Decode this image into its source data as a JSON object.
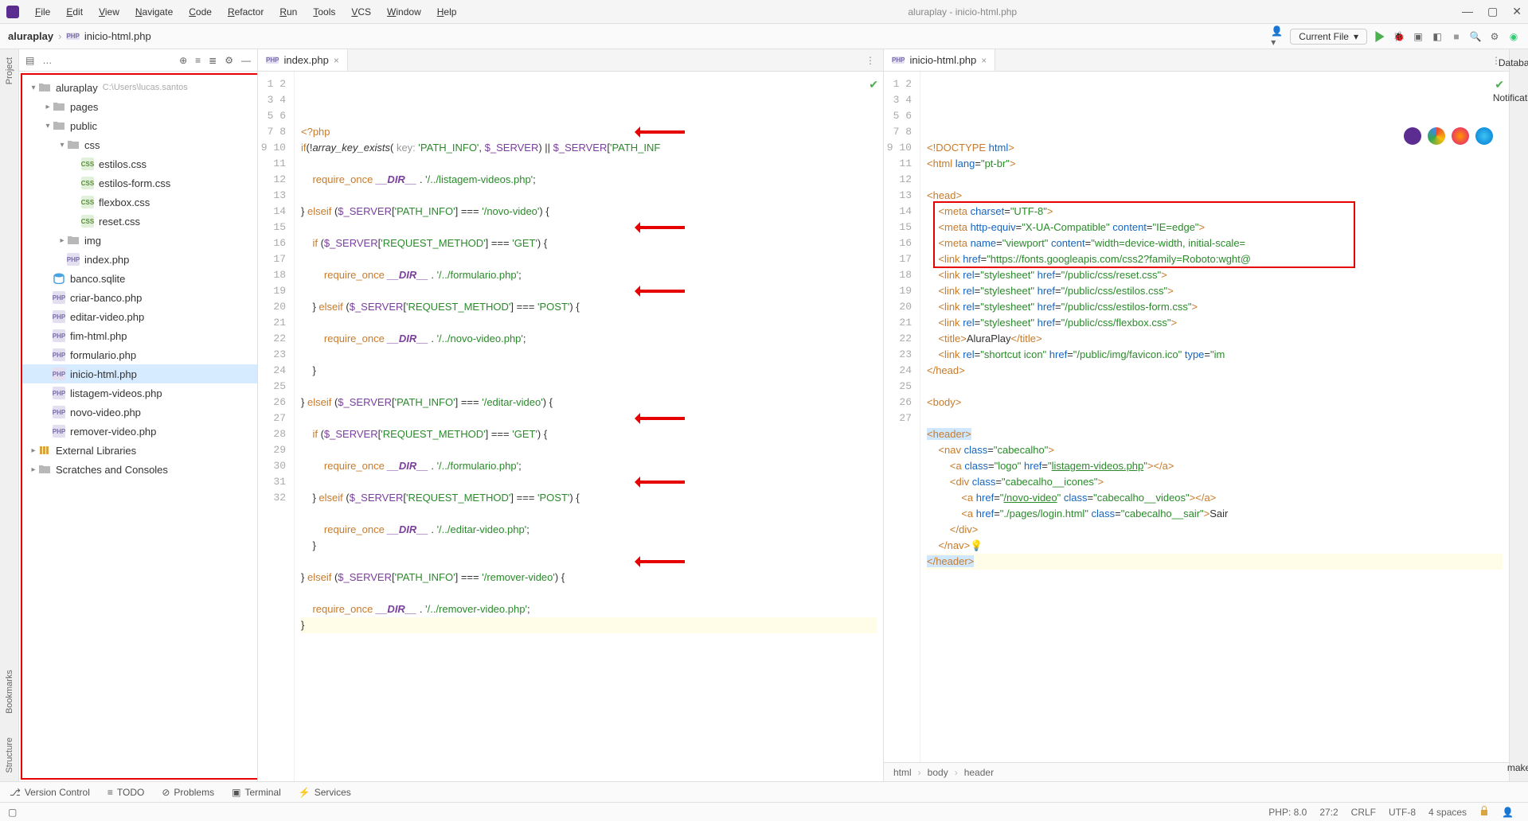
{
  "title": "aluraplay - inicio-html.php",
  "menu": [
    "File",
    "Edit",
    "View",
    "Navigate",
    "Code",
    "Refactor",
    "Run",
    "Tools",
    "VCS",
    "Window",
    "Help"
  ],
  "crumbs": {
    "project": "aluraplay",
    "file": "inicio-html.php"
  },
  "navbar": {
    "target": "Current File"
  },
  "siderail_left": [
    "Project",
    "Bookmarks",
    "Structure"
  ],
  "siderail_right": [
    "Database",
    "Notifications",
    "make"
  ],
  "project_panel": {
    "root": "aluraplay",
    "root_hint": "C:\\Users\\lucas.santos",
    "children": [
      {
        "n": "pages",
        "t": "folder",
        "d": 1,
        "c": "right"
      },
      {
        "n": "public",
        "t": "folder",
        "d": 1,
        "c": "down"
      },
      {
        "n": "css",
        "t": "folder",
        "d": 2,
        "c": "down"
      },
      {
        "n": "estilos.css",
        "t": "css",
        "d": 3
      },
      {
        "n": "estilos-form.css",
        "t": "css",
        "d": 3
      },
      {
        "n": "flexbox.css",
        "t": "css",
        "d": 3
      },
      {
        "n": "reset.css",
        "t": "css",
        "d": 3
      },
      {
        "n": "img",
        "t": "folder",
        "d": 2,
        "c": "right"
      },
      {
        "n": "index.php",
        "t": "php",
        "d": 2
      },
      {
        "n": "banco.sqlite",
        "t": "db",
        "d": 1
      },
      {
        "n": "criar-banco.php",
        "t": "php",
        "d": 1
      },
      {
        "n": "editar-video.php",
        "t": "php",
        "d": 1
      },
      {
        "n": "fim-html.php",
        "t": "php",
        "d": 1
      },
      {
        "n": "formulario.php",
        "t": "php",
        "d": 1
      },
      {
        "n": "inicio-html.php",
        "t": "php",
        "d": 1,
        "sel": true
      },
      {
        "n": "listagem-videos.php",
        "t": "php",
        "d": 1
      },
      {
        "n": "novo-video.php",
        "t": "php",
        "d": 1
      },
      {
        "n": "remover-video.php",
        "t": "php",
        "d": 1
      }
    ],
    "ext_libs": "External Libraries",
    "scratches": "Scratches and Consoles"
  },
  "editor_left": {
    "tab": "index.php",
    "first_line": 1,
    "lines": [
      "<span class='kw'>&lt;?php</span>",
      "<span class='kw'>if</span>(!<span class='fn'>array_key_exists</span>( <span class='hint2'>key:</span> <span class='str'>'PATH_INFO'</span>, <span class='var'>$_SERVER</span>) || <span class='var'>$_SERVER</span>[<span class='str'>'PATH_INF</span>",
      "",
      "    <span class='kw'>require_once</span> <span class='const'>__DIR__</span> . <span class='str'>'/../listagem-videos.php'</span>;",
      "",
      "} <span class='kw'>elseif</span> (<span class='var'>$_SERVER</span>[<span class='str'>'PATH_INFO'</span>] === <span class='str'>'/novo-video'</span>) {",
      "",
      "    <span class='kw'>if</span> (<span class='var'>$_SERVER</span>[<span class='str'>'REQUEST_METHOD'</span>] === <span class='str'>'GET'</span>) {",
      "",
      "        <span class='kw'>require_once</span> <span class='const'>__DIR__</span> . <span class='str'>'/../formulario.php'</span>;",
      "",
      "    } <span class='kw'>elseif</span> (<span class='var'>$_SERVER</span>[<span class='str'>'REQUEST_METHOD'</span>] === <span class='str'>'POST'</span>) {",
      "",
      "        <span class='kw'>require_once</span> <span class='const'>__DIR__</span> . <span class='str'>'/../novo-video.php'</span>;",
      "",
      "    }",
      "",
      "} <span class='kw'>elseif</span> (<span class='var'>$_SERVER</span>[<span class='str'>'PATH_INFO'</span>] === <span class='str'>'/editar-video'</span>) {",
      "",
      "    <span class='kw'>if</span> (<span class='var'>$_SERVER</span>[<span class='str'>'REQUEST_METHOD'</span>] === <span class='str'>'GET'</span>) {",
      "",
      "        <span class='kw'>require_once</span> <span class='const'>__DIR__</span> . <span class='str'>'/../formulario.php'</span>;",
      "",
      "    } <span class='kw'>elseif</span> (<span class='var'>$_SERVER</span>[<span class='str'>'REQUEST_METHOD'</span>] === <span class='str'>'POST'</span>) {",
      "",
      "        <span class='kw'>require_once</span> <span class='const'>__DIR__</span> . <span class='str'>'/../editar-video.php'</span>;",
      "    }",
      "",
      "} <span class='kw'>elseif</span> (<span class='var'>$_SERVER</span>[<span class='str'>'PATH_INFO'</span>] === <span class='str'>'/remover-video'</span>) {",
      "",
      "    <span class='kw'>require_once</span> <span class='const'>__DIR__</span> . <span class='str'>'/../remover-video.php'</span>;",
      "<span class='hlline'>}</span>"
    ],
    "arrows_at": [
      4,
      10,
      14,
      22,
      26,
      31
    ]
  },
  "editor_right": {
    "tab": "inicio-html.php",
    "first_line": 1,
    "lines": [
      "<span class='tag'>&lt;!DOCTYPE</span> <span class='attr'>html</span><span class='tag'>&gt;</span>",
      "<span class='tag'>&lt;html</span> <span class='attr'>lang</span>=<span class='val'>\"pt-br\"</span><span class='tag'>&gt;</span>",
      "",
      "<span class='tag'>&lt;head&gt;</span>",
      "    <span class='tag'>&lt;meta</span> <span class='attr'>charset</span>=<span class='val'>\"UTF-8\"</span><span class='tag'>&gt;</span>",
      "    <span class='tag'>&lt;meta</span> <span class='attr'>http-equiv</span>=<span class='val'>\"X-UA-Compatible\"</span> <span class='attr'>content</span>=<span class='val'>\"IE=edge\"</span><span class='tag'>&gt;</span>",
      "    <span class='tag'>&lt;meta</span> <span class='attr'>name</span>=<span class='val'>\"viewport\"</span> <span class='attr'>content</span>=<span class='val'>\"width=device-width, initial-scale=</span>",
      "    <span class='tag'>&lt;link</span> <span class='attr'>href</span>=<span class='val'>\"https://fonts.googleapis.com/css2?family=Roboto:wght@</span>",
      "    <span class='tag'>&lt;link</span> <span class='attr'>rel</span>=<span class='val'>\"stylesheet\"</span> <span class='attr'>href</span>=<span class='val'>\"/public/css/reset.css\"</span><span class='tag'>&gt;</span>",
      "    <span class='tag'>&lt;link</span> <span class='attr'>rel</span>=<span class='val'>\"stylesheet\"</span> <span class='attr'>href</span>=<span class='val'>\"/public/css/estilos.css\"</span><span class='tag'>&gt;</span>",
      "    <span class='tag'>&lt;link</span> <span class='attr'>rel</span>=<span class='val'>\"stylesheet\"</span> <span class='attr'>href</span>=<span class='val'>\"/public/css/estilos-form.css\"</span><span class='tag'>&gt;</span>",
      "    <span class='tag'>&lt;link</span> <span class='attr'>rel</span>=<span class='val'>\"stylesheet\"</span> <span class='attr'>href</span>=<span class='val'>\"/public/css/flexbox.css\"</span><span class='tag'>&gt;</span>",
      "    <span class='tag'>&lt;title&gt;</span>AluraPlay<span class='tag'>&lt;/title&gt;</span>",
      "    <span class='tag'>&lt;link</span> <span class='attr'>rel</span>=<span class='val'>\"shortcut icon\"</span> <span class='attr'>href</span>=<span class='val'>\"/public/img/favicon.ico\"</span> <span class='attr'>type</span>=<span class='val'>\"im</span>",
      "<span class='tag'>&lt;/head&gt;</span>",
      "",
      "<span class='tag'>&lt;body&gt;</span>",
      "",
      "<span class='tag hlsel'>&lt;header&gt;</span>",
      "    <span class='tag'>&lt;nav</span> <span class='attr'>class</span>=<span class='val'>\"cabecalho\"</span><span class='tag'>&gt;</span>",
      "        <span class='tag'>&lt;a</span> <span class='attr'>class</span>=<span class='val'>\"logo\"</span> <span class='attr'>href</span>=<span class='val'>\"<u>listagem-videos.php</u>\"</span><span class='tag'>&gt;&lt;/a&gt;</span>",
      "        <span class='tag'>&lt;div</span> <span class='attr'>class</span>=<span class='val'>\"cabecalho__icones\"</span><span class='tag'>&gt;</span>",
      "            <span class='tag'>&lt;a</span> <span class='attr'>href</span>=<span class='val'>\"<u>/novo-video</u>\"</span> <span class='attr'>class</span>=<span class='val'>\"cabecalho__videos\"</span><span class='tag'>&gt;&lt;/a&gt;</span>",
      "            <span class='tag'>&lt;a</span> <span class='attr'>href</span>=<span class='val'>\"./pages/login.html\"</span> <span class='attr'>class</span>=<span class='val'>\"cabecalho__sair\"</span><span class='tag'>&gt;</span>Sair",
      "        <span class='tag'>&lt;/div&gt;</span>",
      "    <span class='tag'>&lt;/nav&gt;</span>💡",
      "<span class='hlline'><span class='tag hlsel'>&lt;/header&gt;</span></span>"
    ],
    "crumbtrail": [
      "html",
      "body",
      "header"
    ],
    "redbox_lines": [
      9,
      12
    ]
  },
  "tools": [
    "Version Control",
    "TODO",
    "Problems",
    "Terminal",
    "Services"
  ],
  "status": {
    "php": "PHP: 8.0",
    "pos": "27:2",
    "eol": "CRLF",
    "enc": "UTF-8",
    "indent": "4 spaces"
  }
}
